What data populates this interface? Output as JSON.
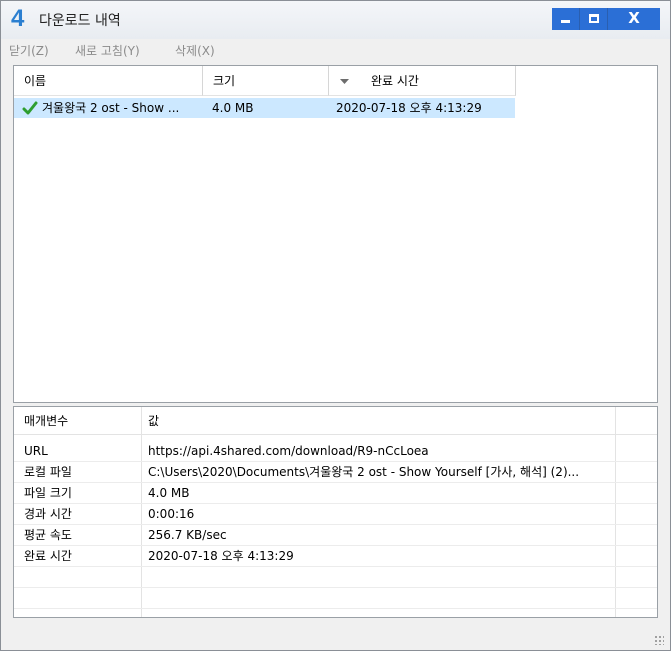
{
  "window": {
    "logo": "4",
    "title": "다운로드 내역",
    "controls": {
      "minimize_icon": "minimize-icon",
      "maximize_icon": "maximize-icon",
      "close": "X"
    }
  },
  "menu": [
    {
      "label": "닫기(Z)"
    },
    {
      "label": "새로 고침(Y)"
    },
    {
      "label": "삭제(X)"
    }
  ],
  "list": {
    "columns": [
      "이름",
      "크기",
      "완료 시간"
    ],
    "sort_icon": "sort-desc-icon",
    "rows": [
      {
        "status_icon": "check-icon",
        "name": "겨울왕국 2 ost - Show ...",
        "size": "4.0 MB",
        "completed": "2020-07-18 오후 4:13:29"
      }
    ]
  },
  "properties": {
    "header": {
      "key": "매개변수",
      "value": "값"
    },
    "rows": [
      {
        "key": "URL",
        "value": "https://api.4shared.com/download/R9-nCcLoea"
      },
      {
        "key": "로컬 파일",
        "value": "C:\\Users\\2020\\Documents\\겨울왕국 2 ost - Show Yourself [가사, 해석] (2)..."
      },
      {
        "key": "파일 크기",
        "value": "4.0 MB"
      },
      {
        "key": "경과 시간",
        "value": "0:00:16"
      },
      {
        "key": "평균 속도",
        "value": "256.7 KB/sec"
      },
      {
        "key": "완료 시간",
        "value": "2020-07-18 오후 4:13:29"
      }
    ]
  },
  "colors": {
    "accent": "#2b6fd6",
    "selection": "#cce8ff",
    "logo": "#2b7fd0"
  }
}
